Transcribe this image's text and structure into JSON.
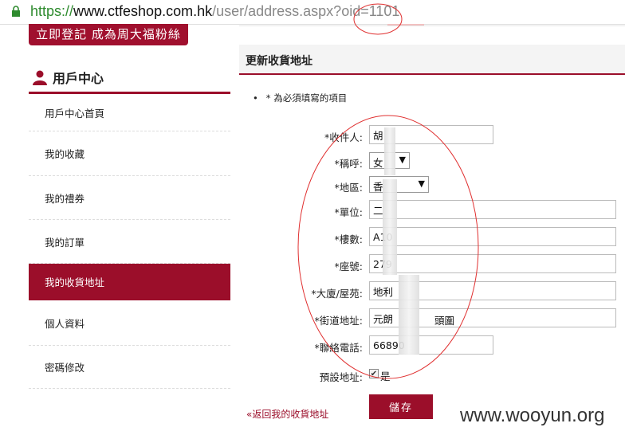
{
  "url": {
    "scheme": "https://",
    "host": "www.ctfeshop.com.hk",
    "path": "/user/address.aspx?oid=1101"
  },
  "banner": {
    "text": "立即登記 成為周大福粉絲"
  },
  "sidebar": {
    "title": "用戶中心",
    "items": [
      {
        "label": "用戶中心首頁"
      },
      {
        "label": "我的收藏"
      },
      {
        "label": "我的禮券"
      },
      {
        "label": "我的訂單"
      },
      {
        "label": "我的收貨地址"
      },
      {
        "label": "個人資料"
      },
      {
        "label": "密碼修改"
      }
    ]
  },
  "main": {
    "title": "更新收貨地址",
    "required_note": "* 為必須填寫的項目",
    "bullet": "•",
    "fields": {
      "recipient": {
        "label": "*收件人:",
        "value": "胡"
      },
      "salutation": {
        "label": "*稱呼:",
        "value": "女",
        "arrow": "▼"
      },
      "region": {
        "label": "*地區:",
        "value": "香",
        "arrow": "▼"
      },
      "unit": {
        "label": "*單位:",
        "value": "二"
      },
      "floor": {
        "label": "*樓數:",
        "value": "A10"
      },
      "block": {
        "label": "*座號:",
        "value": "279"
      },
      "building": {
        "label": "*大廈/屋苑:",
        "value": "地利"
      },
      "street": {
        "label": "*街道地址:",
        "value": "元朗",
        "value_tail": "頭圍"
      },
      "phone": {
        "label": "*聯絡電話:",
        "value": "66890"
      },
      "default_address": {
        "label": "預設地址:",
        "checked_mark": "✔",
        "option": "是"
      }
    },
    "save_label": "儲存",
    "back_link": "«返回我的收貨地址"
  },
  "watermark": "www.wooyun.org",
  "colors": {
    "accent": "#9b0e2a",
    "banner": "#a0102e",
    "annotation": "#e03030",
    "scheme": "#2e8b2e"
  }
}
